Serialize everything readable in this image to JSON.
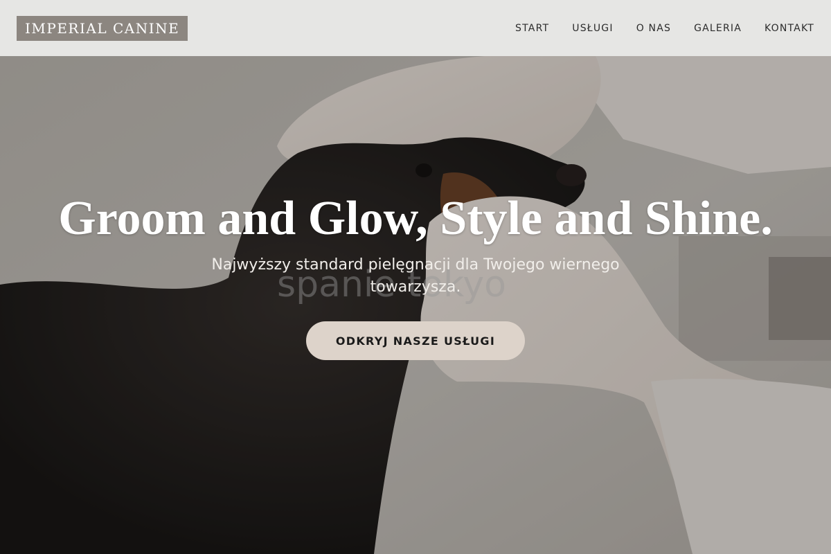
{
  "header": {
    "logo": "IMPERIAL CANINE",
    "nav": [
      "START",
      "USŁUGI",
      "O NAS",
      "GALERIA",
      "KONTAKT"
    ]
  },
  "hero": {
    "headline": "Groom and Glow, Style and Shine.",
    "subtitle": "Najwyższy standard pielęgnacji dla Twojego wiernego towarzysza.",
    "cta": "ODKRYJ NASZE USŁUGI",
    "watermark": "spanie tokyo",
    "image_subject": "dachshund-with-gloved-hands-photo"
  },
  "colors": {
    "header_bg": "#e6e6e4",
    "logo_bg": "#8c8680",
    "cta_bg": "#ddd3ca",
    "text_light": "#ffffff"
  }
}
